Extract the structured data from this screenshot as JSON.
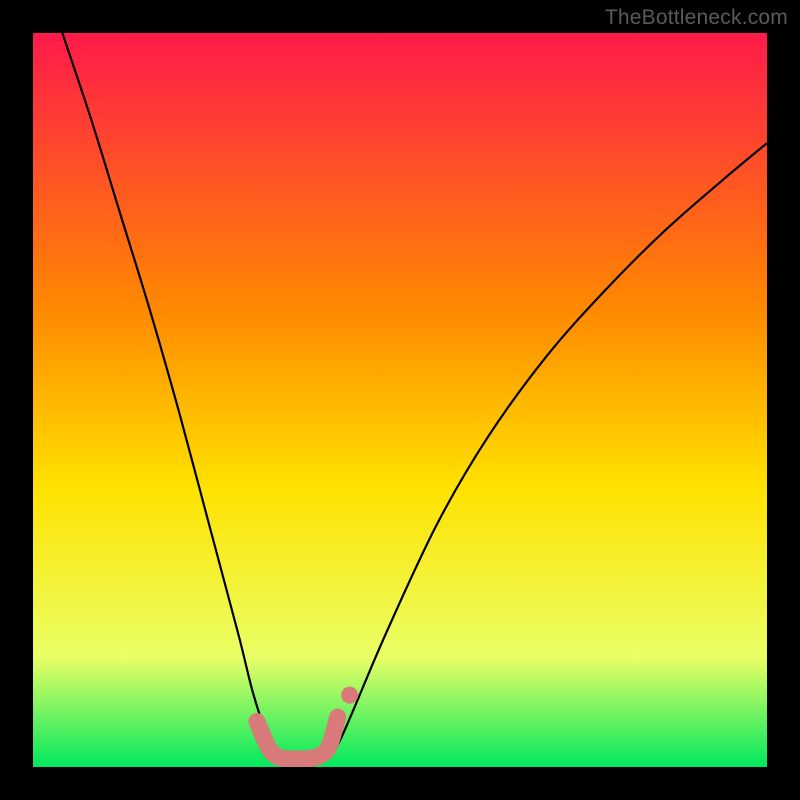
{
  "watermark": "TheBottleneck.com",
  "chart_data": {
    "type": "line",
    "title": "",
    "xlabel": "",
    "ylabel": "",
    "xlim": [
      0,
      100
    ],
    "ylim": [
      0,
      100
    ],
    "background_gradient": {
      "top": "#ff1a4a",
      "mid_upper": "#ff8a00",
      "mid": "#ffe200",
      "lower": "#eaff66",
      "bottom": "#00e85e"
    },
    "series": [
      {
        "name": "bottleneck-curve",
        "color": "#000000",
        "x": [
          4,
          8,
          12,
          16,
          20,
          24,
          28,
          30,
          32,
          33.5,
          35,
          38,
          40,
          42,
          48,
          55,
          62,
          70,
          78,
          86,
          94,
          100
        ],
        "y": [
          100,
          88,
          75,
          62,
          48,
          33,
          18,
          10,
          4,
          1.2,
          1.0,
          1.0,
          1.2,
          4,
          18,
          33,
          45,
          56,
          65,
          73,
          80,
          85
        ]
      }
    ],
    "highlight": {
      "name": "valley-highlight",
      "color": "#d97a7a",
      "x": [
        30.5,
        32,
        33,
        34,
        35,
        36.5,
        38,
        39.5,
        40.5,
        41.5
      ],
      "y": [
        6.2,
        2.8,
        1.6,
        1.2,
        1.1,
        1.1,
        1.2,
        1.8,
        3.2,
        6.8
      ]
    }
  }
}
